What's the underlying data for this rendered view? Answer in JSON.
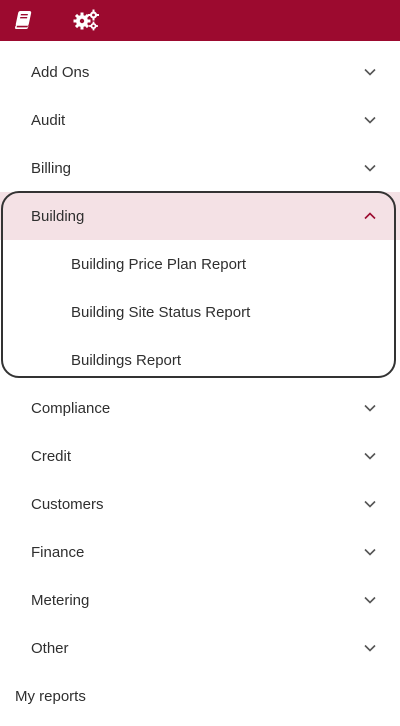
{
  "toolbar": {
    "reports_icon": "book-icon",
    "settings_icon": "gears-icon",
    "bar_color": "#9c0a2f"
  },
  "menu": {
    "items": [
      {
        "label": "Add Ons"
      },
      {
        "label": "Audit"
      },
      {
        "label": "Billing"
      },
      {
        "label": "Building",
        "expanded": true,
        "children": [
          {
            "label": "Building Price Plan Report"
          },
          {
            "label": "Building Site Status Report"
          },
          {
            "label": "Buildings Report"
          }
        ]
      },
      {
        "label": "Compliance"
      },
      {
        "label": "Credit"
      },
      {
        "label": "Customers"
      },
      {
        "label": "Finance"
      },
      {
        "label": "Metering"
      },
      {
        "label": "Other"
      }
    ],
    "my_reports_label": "My reports",
    "active_bg": "#f4e1e5",
    "accent": "#9c0a2f"
  }
}
